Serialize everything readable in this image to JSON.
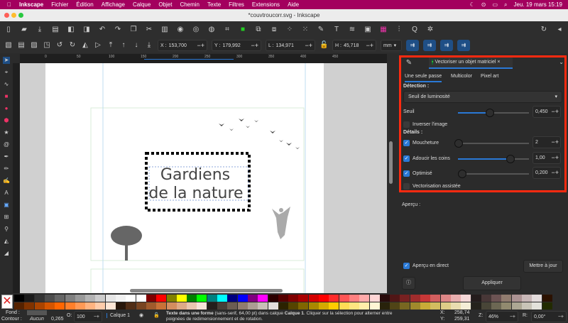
{
  "menubar": {
    "app": "Inkscape",
    "items": [
      "Fichier",
      "Édition",
      "Affichage",
      "Calque",
      "Objet",
      "Chemin",
      "Texte",
      "Filtres",
      "Extensions",
      "Aide"
    ],
    "clock": "Jeu. 19 mars  15:19"
  },
  "window": {
    "title": "*couvtroucorr.svg - Inkscape"
  },
  "toolbar2": {
    "x_label": "X :",
    "x": "153,700",
    "y_label": "Y :",
    "y": "179,992",
    "w_label": "L :",
    "w": "134,971",
    "h_label": "H :",
    "h": "45,718",
    "unit": "mm"
  },
  "ruler": {
    "ticks": [
      "0",
      "50",
      "100",
      "150",
      "200",
      "250",
      "300",
      "350",
      "400",
      "450"
    ]
  },
  "canvas": {
    "text_line1": "Gardiens",
    "text_line2": "de la nature"
  },
  "panel": {
    "tab": "Vectoriser un objet matriciel",
    "subtabs": [
      "Une seule passe",
      "Multicolor",
      "Pixel art"
    ],
    "detection_label": "Détection :",
    "mode": "Seuil de luminosité",
    "seuil_label": "Seuil",
    "seuil": "0,450",
    "seuil_level": 0.45,
    "invert_label": "Inverser l'image",
    "details_label": "Détails :",
    "speckles_label": "Moucheture",
    "speckles": "2",
    "speckles_level": 0.0,
    "smooth_label": "Adoucir les coins",
    "smooth": "1,00",
    "smooth_level": 0.74,
    "optimize_label": "Optimisé",
    "optimize": "0,200",
    "optimize_level": 0.0,
    "assisted_label": "Vectorisation assistée",
    "preview_label": "Aperçu :",
    "live_label": "Aperçu en direct",
    "update": "Mettre à jour",
    "apply": "Appliquer",
    "accent": "#2a79d6"
  },
  "status": {
    "fill_label": "Fond :",
    "stroke_label": "Contour :",
    "stroke_value": "Aucun",
    "stroke_width": "0,265",
    "opacity_label": "O:",
    "opacity": "100",
    "layer": "Calque 1",
    "message_bold": "Texte dans une forme",
    "message": " (sans-serif, 64,00 pt) dans calque ",
    "message_layer": "Calque 1",
    "message_end": ". Cliquer sur la sélection pour alterner entre poignées de redimensionnement et de rotation.",
    "cx": "258,74",
    "cy": "259,31",
    "zoom_label": "Z:",
    "zoom": "46%",
    "rot_label": "R:",
    "rotation": "0,00°"
  },
  "palette": {
    "row1": [
      "#000000",
      "#1a1a1a",
      "#333333",
      "#4d4d4d",
      "#666666",
      "#808080",
      "#999999",
      "#b3b3b3",
      "#cccccc",
      "#e6e6e6",
      "#f2f2f2",
      "#ffffff",
      "#ffffff",
      "#800000",
      "#ff0000",
      "#808000",
      "#ffff00",
      "#008000",
      "#00ff00",
      "#008080",
      "#00ffff",
      "#000080",
      "#0000ff",
      "#800080",
      "#ff00ff",
      "#2b0000",
      "#550000",
      "#800000",
      "#aa0000",
      "#d40000",
      "#ff0000",
      "#ff2a2a",
      "#ff5555",
      "#ff8080",
      "#ffaaaa",
      "#ffd5d5",
      "#280b0b",
      "#501616",
      "#782121",
      "#a02c2c",
      "#c83737",
      "#d35f5f",
      "#de8787",
      "#e9afaf",
      "#f4d7d7",
      "#241c1c",
      "#483737",
      "#6c5353",
      "#917c6f",
      "#ac9393",
      "#c8b7b7",
      "#e3dbdb",
      "#2b1100"
    ],
    "row2": [
      "#552200",
      "#803300",
      "#aa4400",
      "#d45500",
      "#ff6600",
      "#ff7f2a",
      "#ff9955",
      "#ffb380",
      "#ffccaa",
      "#ffe6d5",
      "#28170b",
      "#502d16",
      "#784421",
      "#a05a2c",
      "#c87137",
      "#d38d5f",
      "#deaa87",
      "#e9c6af",
      "#f4e3d7",
      "#241f1c",
      "#483e37",
      "#6c5d53",
      "#917c6f",
      "#ac9d93",
      "#c8beb7",
      "#e3dedb",
      "#2b2200",
      "#554400",
      "#806600",
      "#aa8800",
      "#d4aa00",
      "#ffcc00",
      "#ffdd55",
      "#ffe680",
      "#ffeeaa",
      "#fff6d5",
      "#28220b",
      "#504416",
      "#786721",
      "#a0892c",
      "#c8ab37",
      "#d3bc5f",
      "#decd87",
      "#e9ddaf",
      "#f4eed7",
      "#24221c",
      "#484537",
      "#6c6753",
      "#918a6f",
      "#aca793",
      "#c8c4b7",
      "#e3e2db",
      "#222b00"
    ]
  }
}
